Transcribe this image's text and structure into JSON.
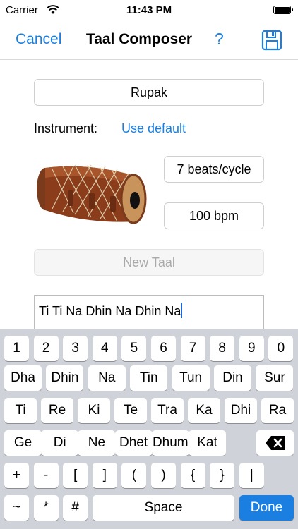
{
  "status_bar": {
    "carrier": "Carrier",
    "time": "11:43 PM"
  },
  "nav": {
    "cancel": "Cancel",
    "title": "Taal Composer",
    "help": "?",
    "save_icon": "save-icon"
  },
  "form": {
    "taal_name": "Rupak",
    "instrument_label": "Instrument:",
    "instrument_value": "Use default",
    "beats": "7 beats/cycle",
    "bpm": "100 bpm",
    "new_taal": "New Taal",
    "bols_text": "Ti Ti Na Dhin Na Dhin Na"
  },
  "keyboard": {
    "row1": [
      "1",
      "2",
      "3",
      "4",
      "5",
      "6",
      "7",
      "8",
      "9",
      "0"
    ],
    "row2": [
      "Dha",
      "Dhin",
      "Na",
      "Tin",
      "Tun",
      "Din",
      "Sur"
    ],
    "row3": [
      "Ti",
      "Re",
      "Ki",
      "Te",
      "Tra",
      "Ka",
      "Dhi",
      "Ra"
    ],
    "row4": [
      "Ge",
      "Di",
      "Ne",
      "Dhet",
      "Dhum",
      "Kat"
    ],
    "row5": [
      "+",
      "-",
      "[",
      "]",
      "(",
      ")",
      "{",
      "}",
      "|"
    ],
    "row6": [
      "~",
      "*",
      "#"
    ],
    "space": "Space",
    "done": "Done",
    "backspace_icon": "backspace-icon"
  },
  "colors": {
    "accent": "#1a7fe0",
    "keyboard_bg": "#cfd3d9"
  }
}
